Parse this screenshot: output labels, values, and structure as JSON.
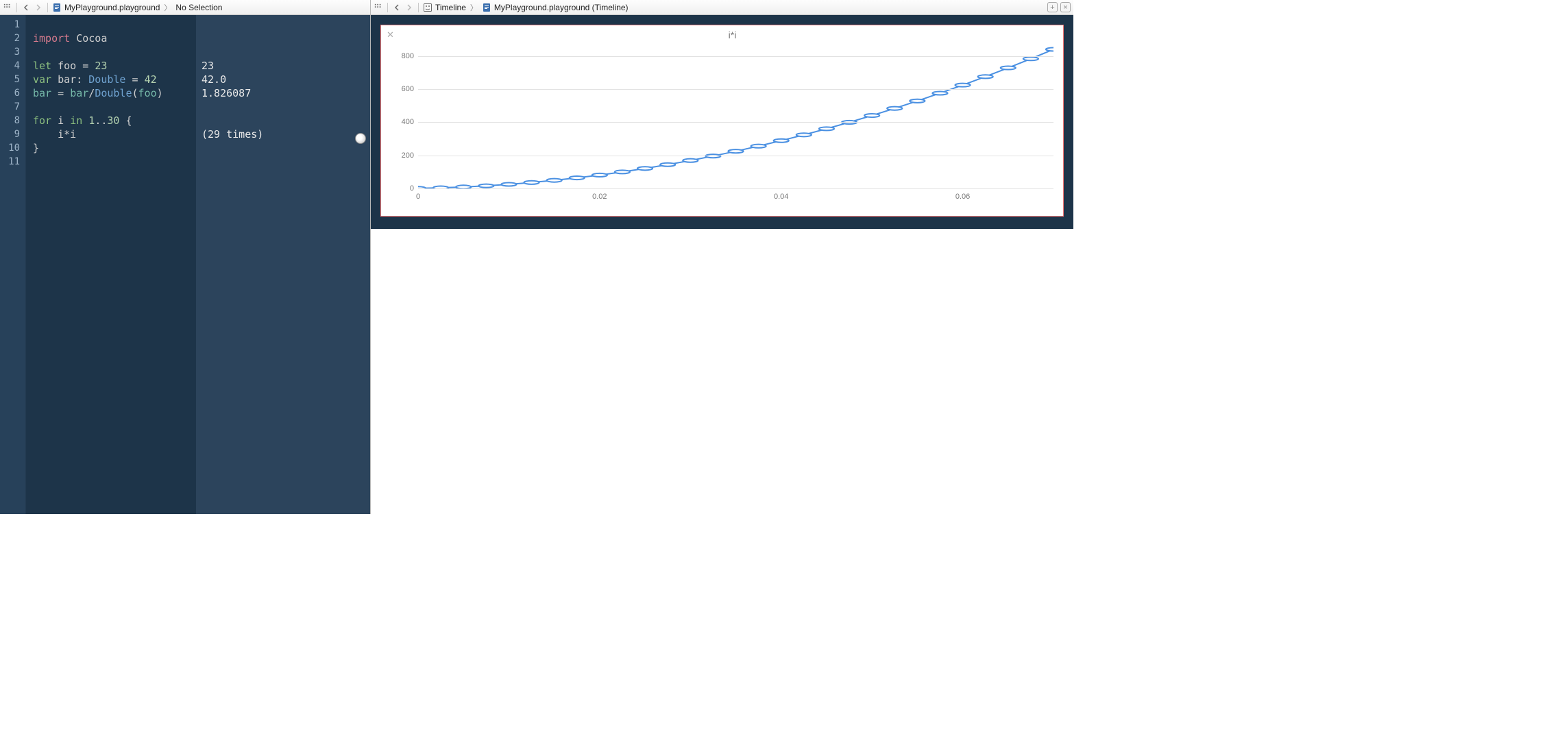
{
  "left": {
    "breadcrumb": {
      "file": "MyPlayground.playground",
      "selection": "No Selection"
    },
    "line_numbers": [
      "1",
      "2",
      "3",
      "4",
      "5",
      "6",
      "7",
      "8",
      "9",
      "10",
      "11"
    ],
    "code_tokens": [
      [],
      [
        {
          "t": "import",
          "c": "kw-pink"
        },
        {
          "t": " ",
          "c": ""
        },
        {
          "t": "Cocoa",
          "c": "punc"
        }
      ],
      [],
      [
        {
          "t": "let",
          "c": "kw-green"
        },
        {
          "t": " foo ",
          "c": "punc"
        },
        {
          "t": "=",
          "c": "punc"
        },
        {
          "t": " ",
          "c": ""
        },
        {
          "t": "23",
          "c": "num"
        }
      ],
      [
        {
          "t": "var",
          "c": "kw-green"
        },
        {
          "t": " bar: ",
          "c": "punc"
        },
        {
          "t": "Double",
          "c": "kw-blue"
        },
        {
          "t": " = ",
          "c": "punc"
        },
        {
          "t": "42",
          "c": "num"
        }
      ],
      [
        {
          "t": "bar",
          "c": "kw-teal"
        },
        {
          "t": " = ",
          "c": "punc"
        },
        {
          "t": "bar",
          "c": "kw-teal"
        },
        {
          "t": "/",
          "c": "punc"
        },
        {
          "t": "Double",
          "c": "kw-blue"
        },
        {
          "t": "(",
          "c": "punc"
        },
        {
          "t": "foo",
          "c": "kw-teal"
        },
        {
          "t": ")",
          "c": "punc"
        }
      ],
      [],
      [
        {
          "t": "for",
          "c": "kw-green"
        },
        {
          "t": " i ",
          "c": "punc"
        },
        {
          "t": "in",
          "c": "kw-green"
        },
        {
          "t": " ",
          "c": ""
        },
        {
          "t": "1",
          "c": "num"
        },
        {
          "t": "..",
          "c": "punc"
        },
        {
          "t": "30",
          "c": "num"
        },
        {
          "t": " {",
          "c": "punc"
        }
      ],
      [
        {
          "t": "    i*i",
          "c": "punc"
        }
      ],
      [
        {
          "t": "}",
          "c": "punc"
        }
      ],
      []
    ],
    "results": [
      "",
      "",
      "",
      "23",
      "42.0",
      "1.826087",
      "",
      "",
      "(29 times)",
      "",
      ""
    ]
  },
  "right": {
    "breadcrumb": {
      "timeline": "Timeline",
      "file": "MyPlayground.playground (Timeline)"
    }
  },
  "chart_data": {
    "type": "line",
    "title": "i*i",
    "xlabel": "",
    "ylabel": "",
    "x_tick_labels": [
      "0",
      "0.02",
      "0.04",
      "0.06"
    ],
    "x_tick_positions": [
      0,
      0.2857,
      0.5714,
      0.8571
    ],
    "y_ticks": [
      0,
      200,
      400,
      600,
      800
    ],
    "ylim": [
      0,
      870
    ],
    "series": [
      {
        "name": "i*i",
        "x": [
          1,
          2,
          3,
          4,
          5,
          6,
          7,
          8,
          9,
          10,
          11,
          12,
          13,
          14,
          15,
          16,
          17,
          18,
          19,
          20,
          21,
          22,
          23,
          24,
          25,
          26,
          27,
          28,
          29
        ],
        "values": [
          1,
          4,
          9,
          16,
          25,
          36,
          49,
          64,
          81,
          100,
          121,
          144,
          169,
          196,
          225,
          256,
          289,
          324,
          361,
          400,
          441,
          484,
          529,
          576,
          625,
          676,
          729,
          784,
          841
        ]
      }
    ]
  }
}
